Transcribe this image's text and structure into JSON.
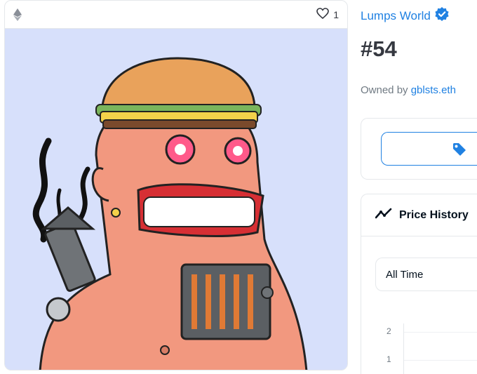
{
  "media": {
    "chain_icon": "ethereum-icon",
    "favorite_icon": "heart-icon",
    "favorite_count": "1",
    "art_background": "#d7e0fb"
  },
  "item": {
    "collection_name": "Lumps World",
    "verified_icon": "verified-badge-icon",
    "title": "#54",
    "owner_prefix": "Owned by",
    "owner_name": "gblsts.eth"
  },
  "offer": {
    "tag_icon": "tag-icon"
  },
  "price_history": {
    "icon": "trend-icon",
    "title": "Price History",
    "time_filter": "All Time",
    "y_ticks": [
      "2",
      "1"
    ]
  },
  "colors": {
    "accent": "#2081e2",
    "text": "#04111d",
    "muted": "#707a83",
    "border": "#e5e8eb"
  }
}
